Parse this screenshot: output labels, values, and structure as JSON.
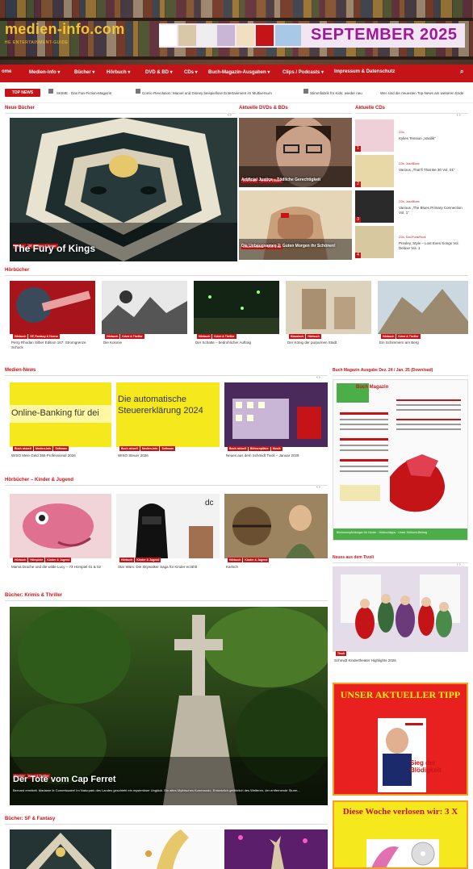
{
  "header": {
    "site_name": "medien-info.com",
    "tagline": "HE ENTERTAINMENT-GUIDE",
    "banner_date": "SEPTEMBER 2025"
  },
  "nav": {
    "items": [
      "ome",
      "Medien-Info ▾",
      "Bücher ▾",
      "Hörbuch ▾",
      "DVD & BD ▾",
      "CDs ▾",
      "Clips / Podcasts ▾",
      "Buch-Magazin-Ausgaben ▾",
      "Impressum & Datenschutz"
    ]
  },
  "ticker": {
    "label": "TOP NEWS",
    "items": [
      "SKIME · Das Fan-Fiction-Magazin",
      "Comic-Revolution: Marvel und Disney beispiellose Entertainment im Multiversum",
      "Stimmfabrik für Kids: wieder neu",
      "Wer sind die neuesten Top-News am weiteren Ende"
    ]
  },
  "sections": {
    "neue_buecher": "Neue Bücher",
    "aktuelle_dvds": "Aktuelle DVDs & BDs",
    "aktuelle_cds": "Aktuelle CDs",
    "hoerbuecher": "Hörbücher",
    "medien_news": "Medien-News",
    "buch_magazin": "Buch Magazin Ausgabe Dez. 24 / Jan. 25 (Download)",
    "hoerbuecher_kinder": "Hörbücher – Kinder & Jugend",
    "neues_tivoli": "Neues aus dem Tivoli",
    "buecher_krimis": "Bücher: Krimis & Thriller",
    "buecher_sf": "Bücher: SF & Fantasy"
  },
  "featured": {
    "title": "The Fury of Kings",
    "tags": [
      "Bücher",
      "SF, Fantasy & Horror"
    ]
  },
  "dvds": [
    {
      "title": "Artificial Justice – Tödliche Gerechtigkeit",
      "tags": [
        "DVD & BD",
        "Krimi & Thriller"
      ]
    },
    {
      "title": "Die Unbeugsamen 2: Guten Morgen ihr Schönen!",
      "tags": [
        "Dokumentation",
        "DVD & BD"
      ]
    }
  ],
  "cds": [
    {
      "num": "1",
      "label": "CDs",
      "title": "Kylies Tension „Vasilik“"
    },
    {
      "num": "2",
      "label": "CDs, Jazz/Blues",
      "title": "Various „That’ll That Be 30 Vol. 01“"
    },
    {
      "num": "3",
      "label": "CDs, Jazz/Blues",
      "title": "Various „The Blues Primary Connection Vol. 1“"
    },
    {
      "num": "4",
      "label": "CDs, Soul/Funk/Rock",
      "title": "Presley, Style – Lost Eves Songs Vol. Deluxe Vol. 1"
    }
  ],
  "hoerbuecher": [
    {
      "caption": "Perry Rhodan Silber Edition 167: Stromgrenze Schock",
      "tags": [
        "Hörbuch",
        "SF, Fantasy & Horror"
      ]
    },
    {
      "caption": "Die Kolonie",
      "tags": [
        "Hörbuch",
        "Krimi & Thriller"
      ]
    },
    {
      "caption": "Der Schatte – bedrohlicher Auftrag",
      "tags": [
        "Hörbuch",
        "Krimi & Thriller"
      ]
    },
    {
      "caption": "Der König der purpurnen Stadt",
      "tags": [
        "Klassisch",
        "Hörbuch"
      ]
    },
    {
      "caption": "Ein Schimmern am Berg",
      "tags": [
        "Hörbuch",
        "Krimi & Thriller"
      ]
    }
  ],
  "news": [
    {
      "image_text": "Online-Banking für dei",
      "caption": "WISO Mein Geld 365 Professional 2026",
      "tags": [
        "Buch aktuell",
        "Medien-Info",
        "Software"
      ]
    },
    {
      "image_text": "Die automatische Steuererklärung 2024",
      "caption": "WISO Steuer 2026",
      "tags": [
        "Buch aktuell",
        "Medien-Info",
        "Software"
      ]
    },
    {
      "image_text": "",
      "caption": "Neues aus dem Schmidt Tivoli – Januar 2026",
      "tags": [
        "Buch aktuell",
        "Bühnenplätze",
        "Musik"
      ]
    }
  ],
  "magazine": {
    "title": "Buch Magazin",
    "footer": "Bücherempfehlungen für Kinder · Hörbuchtipps · Unser Hörbuch-Beitrag"
  },
  "kinder": [
    {
      "caption": "Mama Drache und die wilde Lucy – 73 Hörspiel 01 & 02",
      "tags": [
        "Hörbuch",
        "Hörspiele",
        "Kinder & Jugend"
      ]
    },
    {
      "caption": "Star Wars: Die Skywalker Saga für Kinder erzählt",
      "tags": [
        "Hörbuch",
        "Kinder & Jugend"
      ]
    },
    {
      "caption": "Karlsch",
      "tags": [
        "Hörbuch",
        "Kinder & Jugend"
      ]
    }
  ],
  "tivoli": {
    "caption": "Schmidt Kindertheater Highlights 2026",
    "tags": [
      "Tivoli"
    ]
  },
  "krimi": {
    "title": "Der Tote vom Cap Ferret",
    "tags": [
      "Bücher",
      "Krimi & Thriller"
    ],
    "teaser": "Bernard ermittelt. Madame le Commissaire! Im Naturpark des Landes geschieht ein mysteriöser Unglück. Ein altes Mythisches Kommando. Entsetzlich gefährlich des Weiteren, der entfernende Sturm..."
  },
  "tipp": {
    "headline": "UNSER AKTUELLER TIPP",
    "book_title": "Sieg der Blödigkeit"
  },
  "verlosung": {
    "headline": "Diese Woche verlosen wir: 3 X"
  },
  "colors": {
    "accent": "#c41418",
    "banner_text": "#a0189a",
    "logo": "#f4c430"
  }
}
